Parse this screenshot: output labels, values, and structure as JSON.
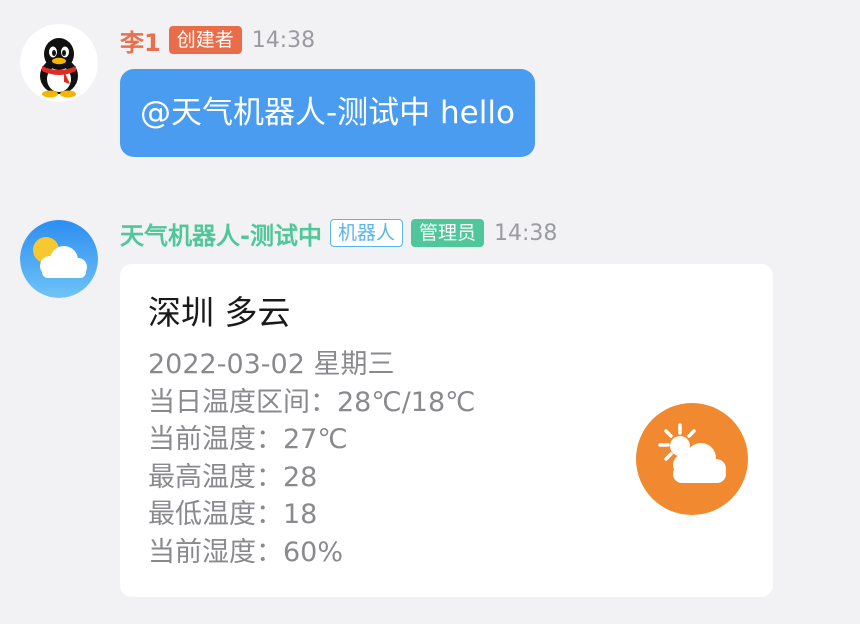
{
  "messages": [
    {
      "sender": "李1",
      "sender_color": "#e8704c",
      "avatar": "qq-penguin-icon",
      "badges": [
        {
          "label": "创建者",
          "style": "filled",
          "color": "#ea6d4a"
        }
      ],
      "time": "14:38",
      "text": "@天气机器人-测试中 hello",
      "bubble_color": "#4a9cf0"
    },
    {
      "sender": "天气机器人-测试中",
      "sender_color": "#4fc79a",
      "avatar": "weather-sun-cloud-icon",
      "badges": [
        {
          "label": "机器人",
          "style": "outline",
          "color": "#5ab6ea"
        },
        {
          "label": "管理员",
          "style": "filled",
          "color": "#4fc79a"
        }
      ],
      "time": "14:38",
      "card": {
        "title": "深圳 多云",
        "lines": [
          "2022-03-02 星期三",
          "当日温度区间：28℃/18℃",
          "当前温度：27℃",
          "最高温度：28",
          "最低温度：18",
          "当前湿度：60%"
        ],
        "icon": "partly-cloudy-icon",
        "icon_color": "#f0892f"
      }
    }
  ]
}
